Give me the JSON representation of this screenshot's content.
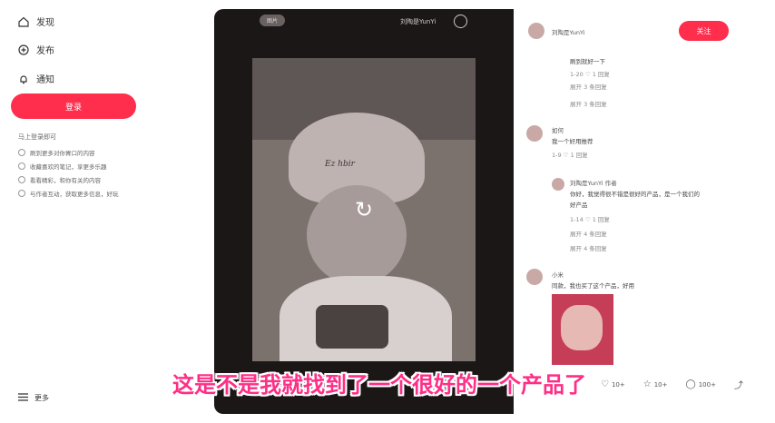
{
  "sidebar": {
    "nav": [
      {
        "label": "发现",
        "icon": "home-icon"
      },
      {
        "label": "发布",
        "icon": "plus-circle-icon"
      },
      {
        "label": "通知",
        "icon": "bell-icon"
      }
    ],
    "login_label": "登录",
    "section_title": "马上登录即可",
    "list": [
      "刷到更多对你胃口的内容",
      "收藏喜欢的笔记，享更多乐趣",
      "看看精彩，和你有关的内容",
      "与作者互动，获取更多信息，好玩"
    ],
    "more_label": "更多"
  },
  "media": {
    "pill_label": "图片",
    "author_name": "刘陶是YunYi",
    "hat_text": "Ez hbir",
    "replay_icon": "replay-icon"
  },
  "comments": {
    "author_name": "刘陶是YunYi",
    "follow_label": "关注",
    "items": [
      {
        "text": "刷到就好一下",
        "meta": "1-20  ♡ 1  回复",
        "replies": "展开 3 条回复"
      },
      {
        "name": "如何",
        "text": "我一个好用推荐",
        "meta": "1-9  ♡ 1  回复"
      },
      {
        "name": "刘陶是YunYi  作者",
        "text": "你好，我觉得很不错是很好的产品，是一个我们的",
        "text2": "好产品",
        "meta": "1-14  ♡ 1  回复",
        "replies": "展开 4 条回复"
      },
      {
        "name": "小米",
        "text": "同款，我也买了这个产品，好用"
      }
    ]
  },
  "bottom_bar": {
    "like": "10+",
    "collect": "10+",
    "comment": "100+"
  },
  "subtitle": "这是不是我就找到了一个很好的一个产品了"
}
